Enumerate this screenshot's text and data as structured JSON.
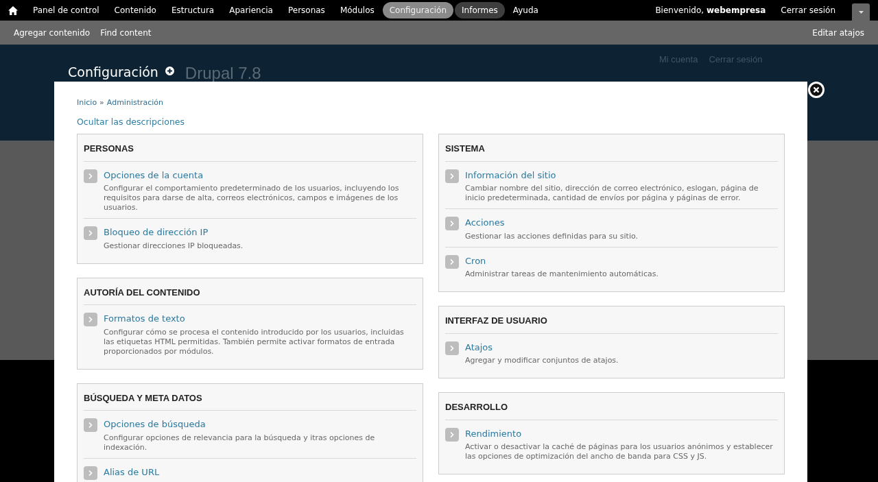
{
  "toolbar": {
    "menu": [
      {
        "label": "Panel de control",
        "selected": false,
        "highlighted": false
      },
      {
        "label": "Contenido",
        "selected": false,
        "highlighted": false
      },
      {
        "label": "Estructura",
        "selected": false,
        "highlighted": false
      },
      {
        "label": "Apariencia",
        "selected": false,
        "highlighted": false
      },
      {
        "label": "Personas",
        "selected": false,
        "highlighted": false
      },
      {
        "label": "Módulos",
        "selected": false,
        "highlighted": false
      },
      {
        "label": "Configuración",
        "selected": true,
        "highlighted": false
      },
      {
        "label": "Informes",
        "selected": false,
        "highlighted": true
      },
      {
        "label": "Ayuda",
        "selected": false,
        "highlighted": false
      }
    ],
    "welcome": "Bienvenido, **webempresa**",
    "logout": "Cerrar sesión"
  },
  "shortcuts": {
    "items": [
      "Agregar contenido",
      "Find content"
    ],
    "edit": "Editar atajos"
  },
  "page_header": {
    "title": "Configuración",
    "site_name": "Drupal 7.8",
    "links": [
      "Mi cuenta",
      "Cerrar sesión"
    ]
  },
  "overlay": {
    "breadcrumb": [
      "Inicio",
      "Administración"
    ],
    "separator": "»",
    "toggle_descriptions": "Ocultar las descripciones",
    "columns": [
      [
        {
          "title": "PERSONAS",
          "items": [
            {
              "title": "Opciones de la cuenta",
              "description": "Configurar el comportamiento predeterminado de los usuarios, incluyendo los requisitos para darse de alta, correos electrónicos, campos e imágenes de los usuarios."
            },
            {
              "title": "Bloqueo de dirección IP",
              "description": "Gestionar direcciones IP bloqueadas."
            }
          ]
        },
        {
          "title": "AUTORÍA DEL CONTENIDO",
          "items": [
            {
              "title": "Formatos de texto",
              "description": "Configurar cómo se procesa el contenido introducido por los usuarios, incluidas las etiquetas HTML permitidas. También permite activar formatos de entrada proporcionados por módulos."
            }
          ]
        },
        {
          "title": "BÚSQUEDA Y META DATOS",
          "items": [
            {
              "title": "Opciones de búsqueda",
              "description": "Configurar opciones de relevancia para la búsqueda y itras opciones de indexación."
            },
            {
              "title": "Alias de URL"
            }
          ]
        }
      ],
      [
        {
          "title": "SISTEMA",
          "items": [
            {
              "title": "Información del sitio",
              "description": "Cambiar nombre del sitio, dirección de correo electrónico, eslogan, página de inicio predeterminada, cantidad de envíos por página y páginas de error."
            },
            {
              "title": "Acciones",
              "description": "Gestionar las acciones definidas para su sitio."
            },
            {
              "title": "Cron",
              "description": "Administrar tareas de mantenimiento automáticas."
            }
          ]
        },
        {
          "title": "INTERFAZ DE USUARIO",
          "items": [
            {
              "title": "Atajos",
              "description": "Agregar y modificar conjuntos de atajos."
            }
          ]
        },
        {
          "title": "DESARROLLO",
          "items": [
            {
              "title": "Rendimiento",
              "description": "Activar o desactivar la caché de páginas para los usuarios anónimos y establecer las opciones de optimización del ancho de banda para CSS y JS."
            }
          ]
        }
      ]
    ]
  }
}
